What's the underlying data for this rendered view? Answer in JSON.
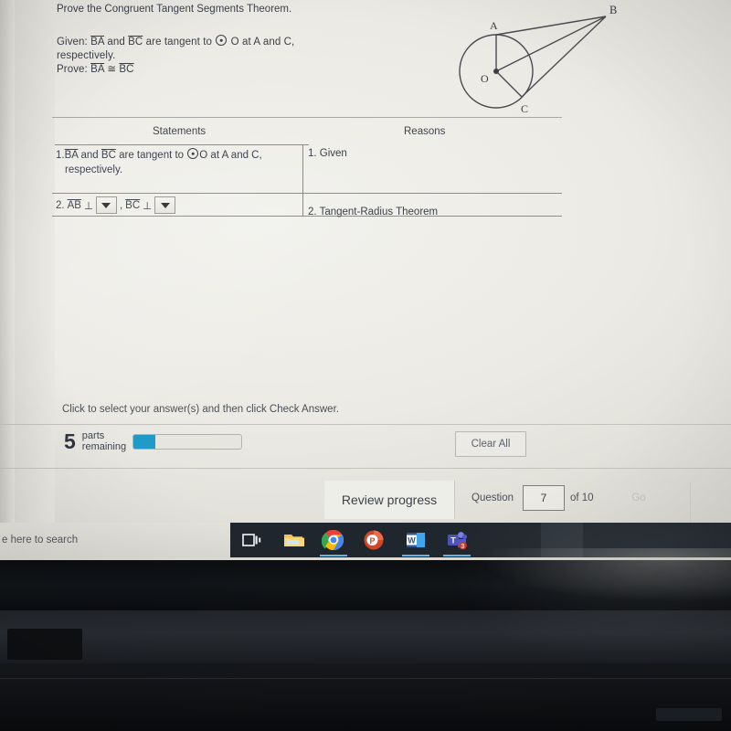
{
  "problem": {
    "title": "Prove the Congruent Tangent Segments Theorem.",
    "given_label": "Given:",
    "given_pre": "BA",
    "given_mid": "and",
    "given_seg2": "BC",
    "given_tail": "are tangent to",
    "given_circle_name": "O at A and C,",
    "given_respectively": "respectively.",
    "prove_label": "Prove:",
    "prove_seg1": "BA",
    "prove_symbol": "≅",
    "prove_seg2": "BC"
  },
  "diagram": {
    "label_a": "A",
    "label_b": "B",
    "label_c": "C",
    "label_o": "O",
    "stroke": "#4a4a52"
  },
  "table": {
    "header_statements": "Statements",
    "header_reasons": "Reasons",
    "rows": [
      {
        "num": "1.",
        "statement_seg1": "BA",
        "statement_and": "and",
        "statement_seg2": "BC",
        "statement_tail": "are tangent to",
        "statement_circle": "O at A and C,",
        "statement_second_line": "respectively.",
        "reason": "1. Given"
      },
      {
        "num": "2.",
        "statement_seg1": "AB",
        "perp": "⊥",
        "comma": ",",
        "statement_seg2": "BC",
        "reason": "2. Tangent-Radius Theorem",
        "dropdown1_value": "",
        "dropdown2_value": ""
      }
    ]
  },
  "status": {
    "instruction": "Click to select your answer(s) and then click Check Answer.",
    "parts_count": "5",
    "parts_label_line1": "parts",
    "parts_label_line2": "remaining",
    "progress_percent": 20,
    "progress_color": "#1f9ac9",
    "clear_all_label": "Clear All"
  },
  "footer": {
    "review_label": "Review progress",
    "question_label": "Question",
    "question_number": "7",
    "of_label": "of 10",
    "go_label": "Go"
  },
  "taskbar": {
    "search_placeholder": "e here to search",
    "icons": [
      {
        "name": "task-view-icon",
        "label": "Task View"
      },
      {
        "name": "file-explorer-icon",
        "label": "File Explorer"
      },
      {
        "name": "chrome-icon",
        "label": "Google Chrome"
      },
      {
        "name": "powerpoint-icon",
        "label": "PowerPoint"
      },
      {
        "name": "word-icon",
        "label": "Word"
      },
      {
        "name": "teams-icon",
        "label": "Microsoft Teams"
      }
    ],
    "teams_badge": "3"
  }
}
